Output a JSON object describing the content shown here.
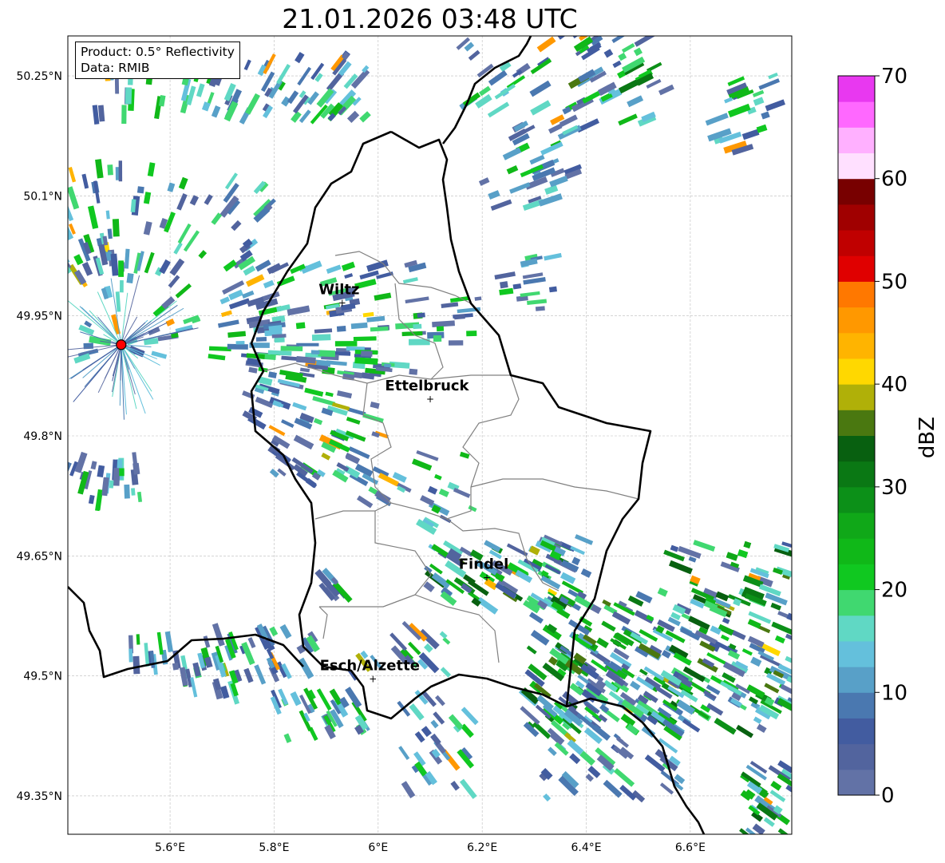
{
  "title": "21.01.2026 03:48 UTC",
  "info": {
    "product": "Product: 0.5° Reflectivity",
    "data": "Data: RMIB"
  },
  "map_extent": {
    "lon": [
      5.4035,
      6.795
    ],
    "lat": [
      49.302,
      50.3
    ]
  },
  "lon_ticks": [
    {
      "v": 5.6,
      "label": "5.6°E"
    },
    {
      "v": 5.8,
      "label": "5.8°E"
    },
    {
      "v": 6.0,
      "label": "6°E"
    },
    {
      "v": 6.2,
      "label": "6.2°E"
    },
    {
      "v": 6.4,
      "label": "6.4°E"
    },
    {
      "v": 6.6,
      "label": "6.6°E"
    }
  ],
  "lat_ticks": [
    {
      "v": 50.25,
      "label": "50.25°N"
    },
    {
      "v": 50.1,
      "label": "50.1°N"
    },
    {
      "v": 49.95,
      "label": "49.95°N"
    },
    {
      "v": 49.8,
      "label": "49.8°N"
    },
    {
      "v": 49.65,
      "label": "49.65°N"
    },
    {
      "v": 49.5,
      "label": "49.5°N"
    },
    {
      "v": 49.35,
      "label": "49.35°N"
    }
  ],
  "cities": [
    {
      "name": "Wiltz",
      "lon": 5.931,
      "lat": 49.967
    },
    {
      "name": "Ettelbruck",
      "lon": 6.1,
      "lat": 49.847
    },
    {
      "name": "Findel",
      "lon": 6.209,
      "lat": 49.624
    },
    {
      "name": "Esch/Alzette",
      "lon": 5.99,
      "lat": 49.497
    }
  ],
  "radar_site": {
    "lon": 5.506,
    "lat": 49.914,
    "color": "#ff0000"
  },
  "colorbar": {
    "label": "dBZ",
    "min": 0,
    "max": 70,
    "step": 2.5,
    "ticks": [
      "0",
      "10",
      "20",
      "30",
      "40",
      "50",
      "60",
      "70"
    ],
    "colors": [
      "#6272a6",
      "#52649e",
      "#425ca0",
      "#4a78b0",
      "#58a0c8",
      "#64c0dc",
      "#60d8c4",
      "#40d870",
      "#10c820",
      "#10b818",
      "#10a818",
      "#0c9018",
      "#0a7814",
      "#086010",
      "#4a7810",
      "#b0b008",
      "#ffd800",
      "#ffb400",
      "#ff9800",
      "#ff7800",
      "#e00000",
      "#c00000",
      "#a00000",
      "#780000",
      "#ffe0ff",
      "#ffb0ff",
      "#ff68ff",
      "#e838f0"
    ]
  }
}
